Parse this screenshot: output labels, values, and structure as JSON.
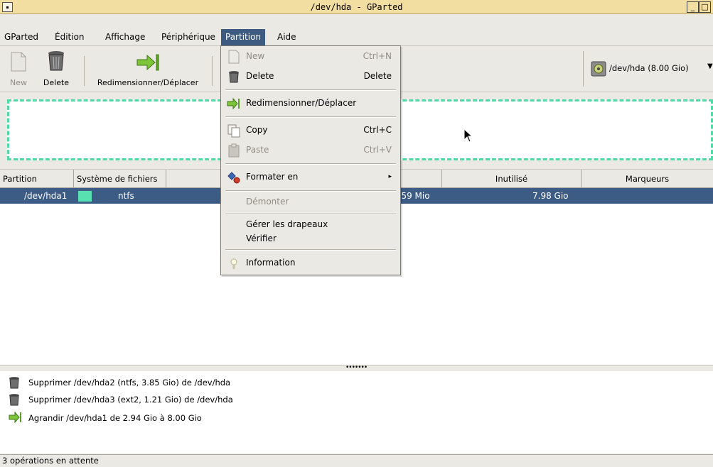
{
  "window": {
    "title": "/dev/hda - GParted",
    "min_glyph": "_",
    "max_glyph": "□"
  },
  "menubar": {
    "items": [
      "GParted",
      "Édition",
      "Affichage",
      "Périphérique",
      "Partition",
      "Aide"
    ]
  },
  "toolbar": {
    "new_label": "New",
    "delete_label": "Delete",
    "resize_label": "Redimensionner/Déplacer",
    "device_label": "/dev/hda  (8.00 Gio)"
  },
  "table": {
    "headers": [
      "Partition",
      "Système de fichiers",
      "Inutilisé",
      "Marqueurs"
    ],
    "rows": [
      {
        "partition": "/dev/hda1",
        "filesystem": "ntfs",
        "used_partial": "5.59 Mio",
        "unused": "7.98 Gio",
        "flags": ""
      }
    ]
  },
  "partition_menu": {
    "items": [
      {
        "label": "New",
        "accel": "Ctrl+N",
        "disabled": true,
        "icon": "new-icon"
      },
      {
        "label": "Delete",
        "accel": "Delete",
        "disabled": false,
        "icon": "delete-icon"
      },
      {
        "label": "Redimensionner/Déplacer",
        "accel": "",
        "disabled": false,
        "icon": "resize-icon"
      },
      {
        "label": "Copy",
        "accel": "Ctrl+C",
        "disabled": false,
        "icon": "copy-icon"
      },
      {
        "label": "Paste",
        "accel": "Ctrl+V",
        "disabled": true,
        "icon": "paste-icon"
      },
      {
        "label": "Formater en",
        "accel": "▸",
        "disabled": false,
        "icon": "format-icon"
      },
      {
        "label": "Démonter",
        "accel": "",
        "disabled": true,
        "icon": ""
      },
      {
        "label": "Gérer les drapeaux",
        "accel": "",
        "disabled": false,
        "icon": ""
      },
      {
        "label": "Vérifier",
        "accel": "",
        "disabled": false,
        "icon": ""
      },
      {
        "label": "Information",
        "accel": "",
        "disabled": false,
        "icon": "information-icon"
      }
    ]
  },
  "operations": [
    {
      "text": "Supprimer /dev/hda2 (ntfs, 3.85 Gio) de /dev/hda",
      "icon": "delete-icon"
    },
    {
      "text": "Supprimer /dev/hda3 (ext2, 1.21 Gio) de /dev/hda",
      "icon": "delete-icon"
    },
    {
      "text": "Agrandir /dev/hda1 de 2.94 Gio à 8.00 Gio",
      "icon": "resize-icon"
    }
  ],
  "statusbar": {
    "text": "3 opérations en attente"
  },
  "pane_handle": {
    "glyph": "•••••••"
  },
  "colors": {
    "titlebar": "#f2dea0",
    "selection": "#3c5c86",
    "ntfs": "#59e0b0",
    "menu_active": "#3d5a80"
  }
}
